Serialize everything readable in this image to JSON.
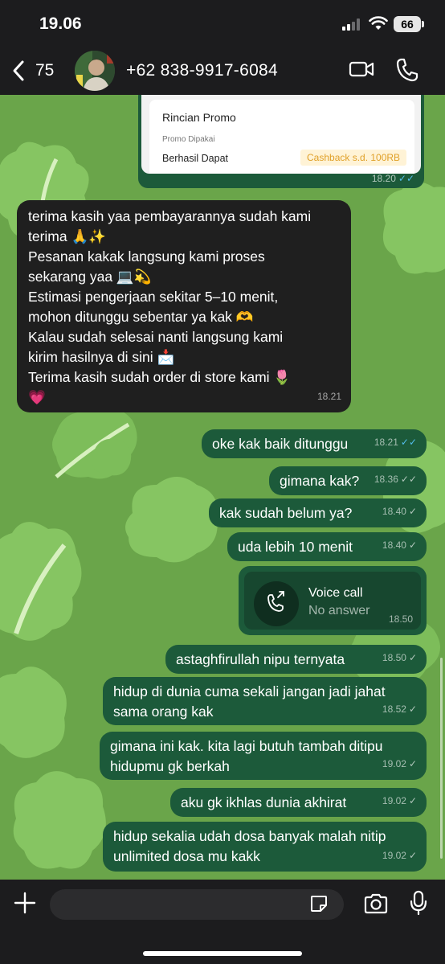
{
  "status_bar": {
    "time": "19.06",
    "battery": "66"
  },
  "header": {
    "back_count": "75",
    "contact": "+62 838-9917-6084"
  },
  "promo": {
    "title": "Rincian Promo",
    "subtitle": "Promo Dipakai",
    "row_label": "Berhasil Dapat",
    "badge": "Cashback s.d. 100RB",
    "time": "18.20"
  },
  "incoming": {
    "lines": [
      "terima kasih yaa pembayarannya sudah kami",
      "terima 🙏✨",
      "Pesanan kakak langsung kami proses",
      "sekarang yaa 💻💫",
      "Estimasi pengerjaan sekitar 5–10 menit,",
      "mohon ditunggu sebentar ya kak 🫶",
      "Kalau sudah selesai nanti langsung kami",
      "kirim hasilnya di sini 📩",
      "Terima kasih sudah order di store kami 🌷",
      "💗"
    ],
    "time": "18.21"
  },
  "messages": [
    {
      "lines": [
        "oke kak baik ditunggu"
      ],
      "time": "18.21",
      "status": "read"
    },
    {
      "lines": [
        "gimana kak?"
      ],
      "time": "18.36",
      "status": "delivered"
    },
    {
      "lines": [
        "kak sudah belum ya?"
      ],
      "time": "18.40",
      "status": "sent"
    },
    {
      "lines": [
        "uda lebih 10 menit"
      ],
      "time": "18.40",
      "status": "sent"
    },
    {
      "lines": [
        "astaghfirullah nipu ternyata"
      ],
      "time": "18.50",
      "status": "sent"
    },
    {
      "lines": [
        "hidup di dunia cuma sekali jangan jadi jahat",
        "sama orang kak"
      ],
      "time": "18.52",
      "status": "sent"
    },
    {
      "lines": [
        "gimana ini kak. kita lagi butuh tambah ditipu",
        "hidupmu gk berkah"
      ],
      "time": "19.02",
      "status": "sent"
    },
    {
      "lines": [
        "aku gk ikhlas dunia akhirat"
      ],
      "time": "19.02",
      "status": "sent"
    },
    {
      "lines": [
        "hidup sekalia udah dosa banyak malah nitip",
        "unlimited dosa mu kakk"
      ],
      "time": "19.02",
      "status": "sent"
    }
  ],
  "voice_call": {
    "title": "Voice call",
    "subtitle": "No answer",
    "time": "18.50"
  },
  "ticks": {
    "sent": "✓",
    "double": "✓✓"
  },
  "colors": {
    "outgoing_bubble": "#1c5a3a",
    "incoming_bubble": "#1f1f1f",
    "wallpaper": "#6aa54a",
    "read_tick": "#53bdeb"
  },
  "icons": [
    "back-chevron-icon",
    "video-call-icon",
    "phone-icon",
    "plus-icon",
    "sticker-icon",
    "camera-icon",
    "mic-icon",
    "phone-missed-icon"
  ]
}
